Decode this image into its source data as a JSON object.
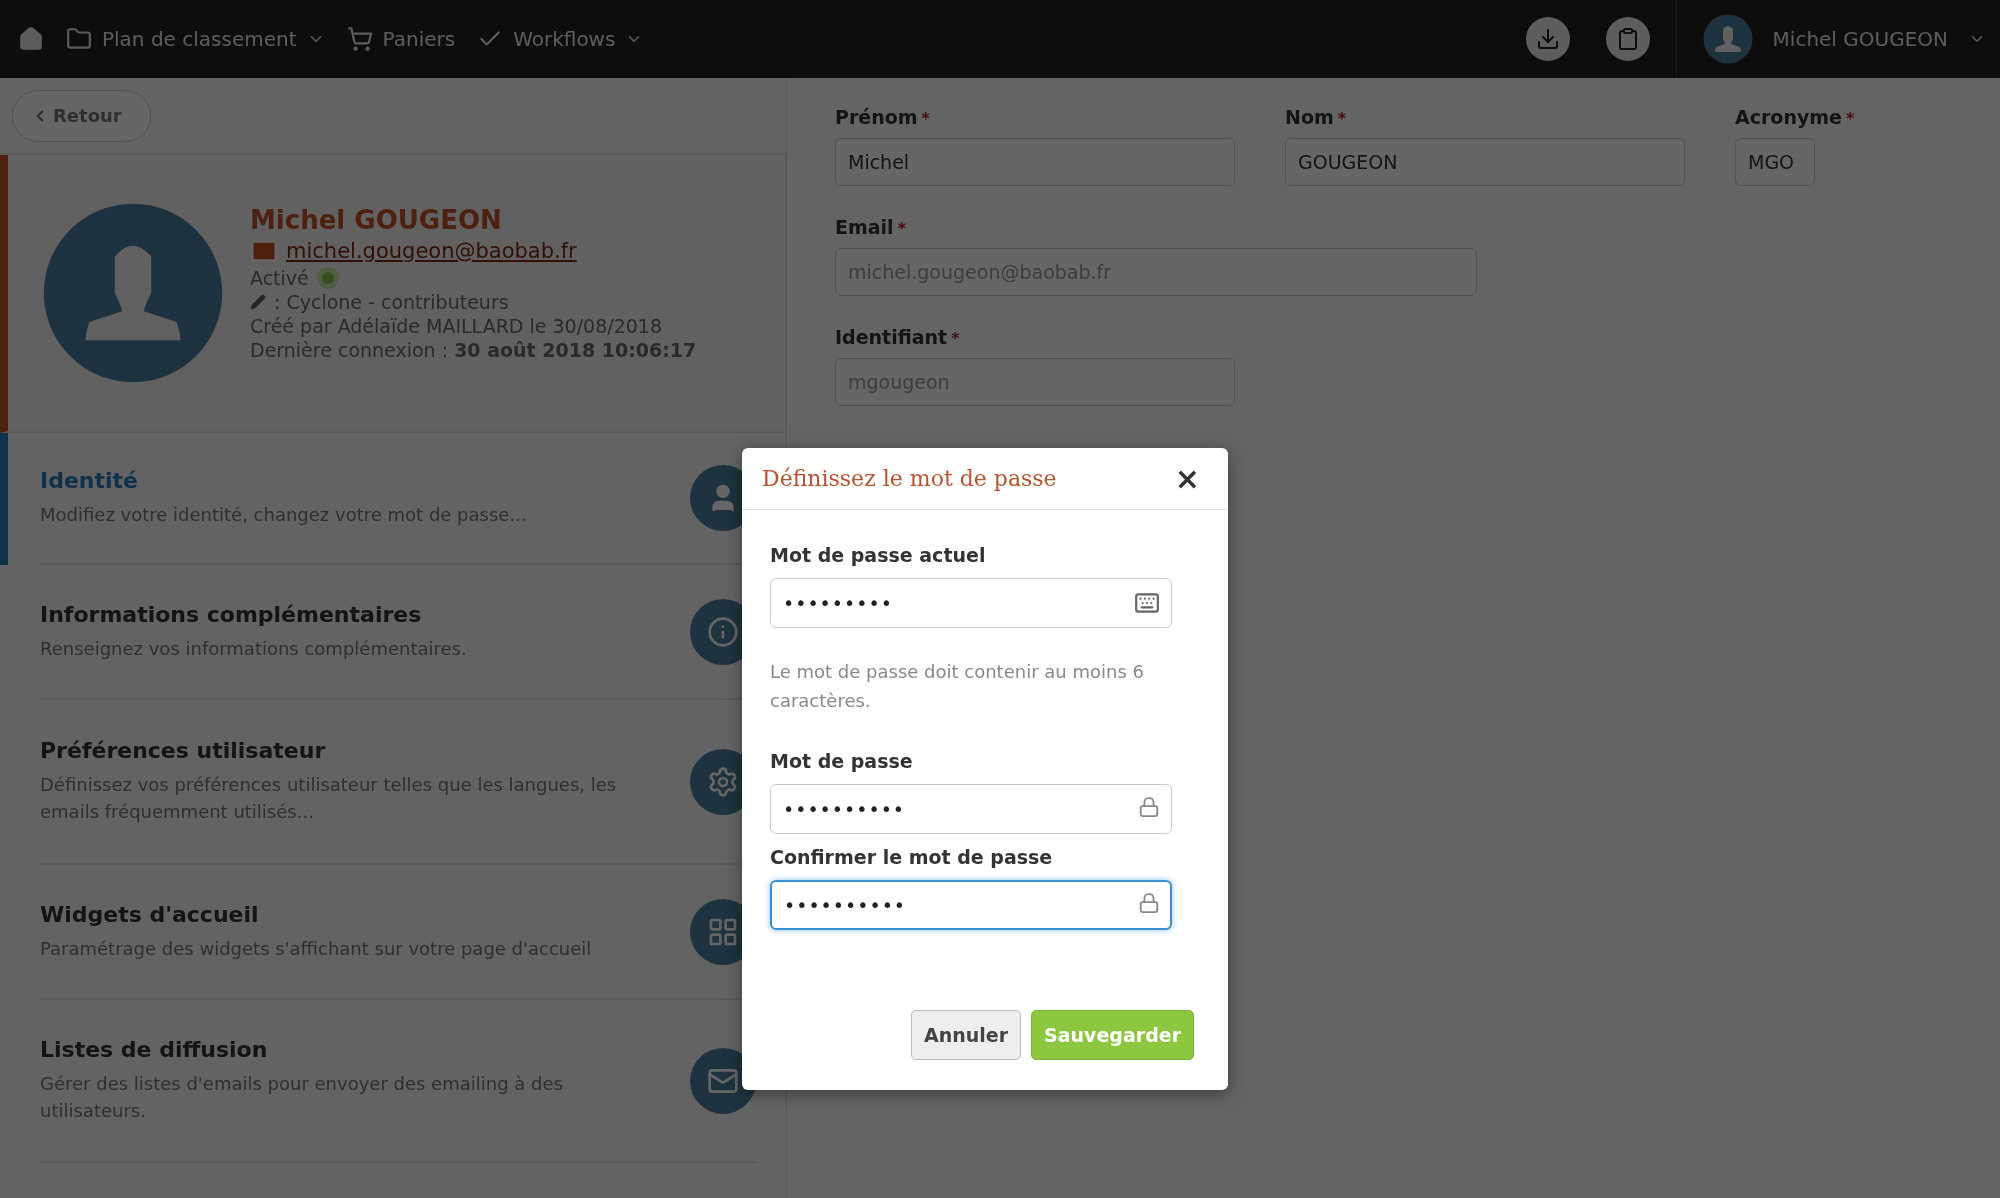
{
  "topbar": {
    "nav": [
      {
        "kind": "home"
      },
      {
        "kind": "folder",
        "label": "Plan de classement",
        "dropdown": true
      },
      {
        "kind": "cart",
        "label": "Paniers",
        "dropdown": false
      },
      {
        "kind": "check",
        "label": "Workflows",
        "dropdown": true
      }
    ],
    "user": {
      "name": "Michel GOUGEON",
      "dropdown": true
    }
  },
  "back_button": "Retour",
  "profile": {
    "name": "Michel GOUGEON",
    "email": "michel.gougeon@baobab.fr",
    "status": "Activé",
    "active": true,
    "group": ": Cyclone - contributeurs",
    "created": "Créé par Adélaïde MAILLARD le 30/08/2018",
    "last_login_label": "Dernière connexion : ",
    "last_login": "30 août 2018 10:06:17"
  },
  "sections": [
    {
      "kind": "user",
      "title": "Identité",
      "description": "Modifiez votre identité, changez votre mot de passe...",
      "selected": true
    },
    {
      "kind": "info",
      "title": "Informations complémentaires",
      "description": "Renseignez vos informations complémentaires.",
      "selected": false
    },
    {
      "kind": "gear",
      "title": "Préférences utilisateur",
      "description": "Définissez vos préférences utilisateur telles que les langues, les emails fréquemment utilisés...",
      "selected": false
    },
    {
      "kind": "grid",
      "title": "Widgets d'accueil",
      "description": "Paramétrage des widgets s'affichant sur votre page d'accueil",
      "selected": false
    },
    {
      "kind": "mail",
      "title": "Listes de diffusion",
      "description": "Gérer des listes d'emails pour envoyer des emailing à des utilisateurs.",
      "selected": false
    }
  ],
  "form": {
    "rows": [
      [
        {
          "label": "Prénom",
          "value": "Michel",
          "required_mark": "*",
          "disabled": false
        },
        {
          "label": "Nom",
          "value": "GOUGEON",
          "required_mark": "*",
          "disabled": false
        },
        {
          "label": "Acronyme",
          "value": "MGO",
          "required_mark": "*",
          "disabled": false
        }
      ],
      [
        {
          "label": "Email",
          "value": "michel.gougeon@baobab.fr",
          "required_mark": "*",
          "disabled": true
        }
      ],
      [
        {
          "label": "Identifiant",
          "value": "mgougeon",
          "required_mark": "*",
          "disabled": true
        }
      ]
    ]
  },
  "modal": {
    "title": "Définissez le mot de passe",
    "close": "×",
    "fields": [
      {
        "label": "Mot de passe actuel",
        "value": "•••••••••",
        "focused": false,
        "hint": "Le mot de passe doit contenir au moins 6 caractères."
      },
      {
        "label": "Mot de passe",
        "value": "••••••••••",
        "focused": false
      },
      {
        "label": "Confirmer le mot de passe",
        "value": "••••••••••",
        "focused": true
      }
    ],
    "buttons": [
      {
        "kind": "secondary",
        "label": "Annuler"
      },
      {
        "kind": "primary",
        "label": "Sauvegarder"
      }
    ]
  }
}
